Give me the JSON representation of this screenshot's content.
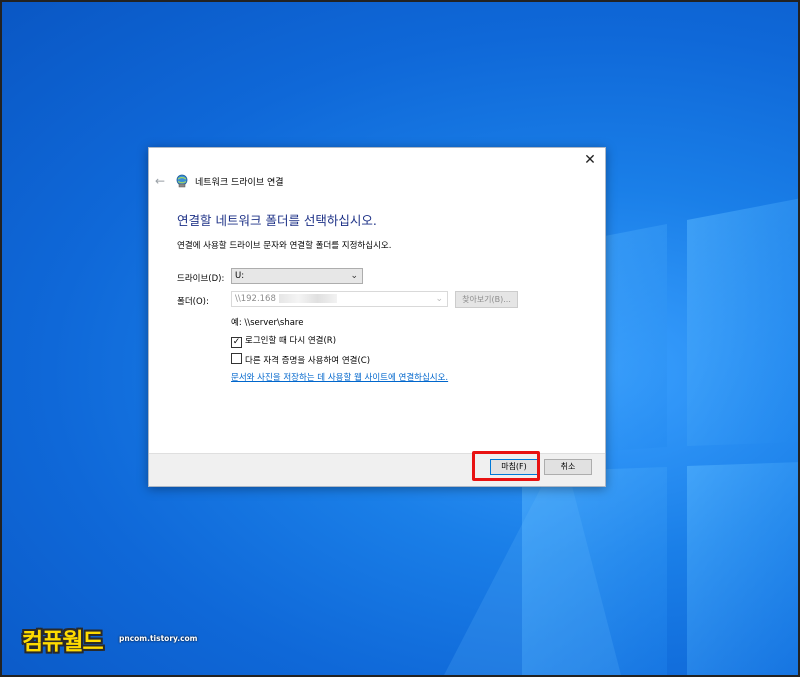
{
  "colors": {
    "desktop_blue": "#0f68d8",
    "heading_blue": "#1e3287",
    "link_blue": "#0066cc",
    "highlight_red": "#e81212",
    "watermark_yellow": "#ffdc00"
  },
  "dialog": {
    "title": "네트워크 드라이브 연결",
    "close_symbol": "✕",
    "back_symbol": "←",
    "heading": "연결할 네트워크 폴더를 선택하십시오.",
    "description": "연결에 사용할 드라이브 문자와 연결할 폴더를 지정하십시오.",
    "drive": {
      "label": "드라이브(D):",
      "value": "U:"
    },
    "folder": {
      "label": "폴더(O):",
      "value": "\\\\192.168"
    },
    "browse_label": "찾아보기(B)...",
    "example": "예: \\\\server\\share",
    "reconnect": {
      "label": "로그인할 때 다시 연결(R)",
      "checked": true
    },
    "credentials": {
      "label": "다른 자격 증명을 사용하여 연결(C)",
      "checked": false
    },
    "link_text": "문서와 사진을 저장하는 데 사용할 웹 사이트에 연결하십시오.",
    "finish_label": "마침(F)",
    "cancel_label": "취소"
  },
  "watermark": {
    "main": "컴퓨월드",
    "sub": "pncom.tistory.com"
  }
}
